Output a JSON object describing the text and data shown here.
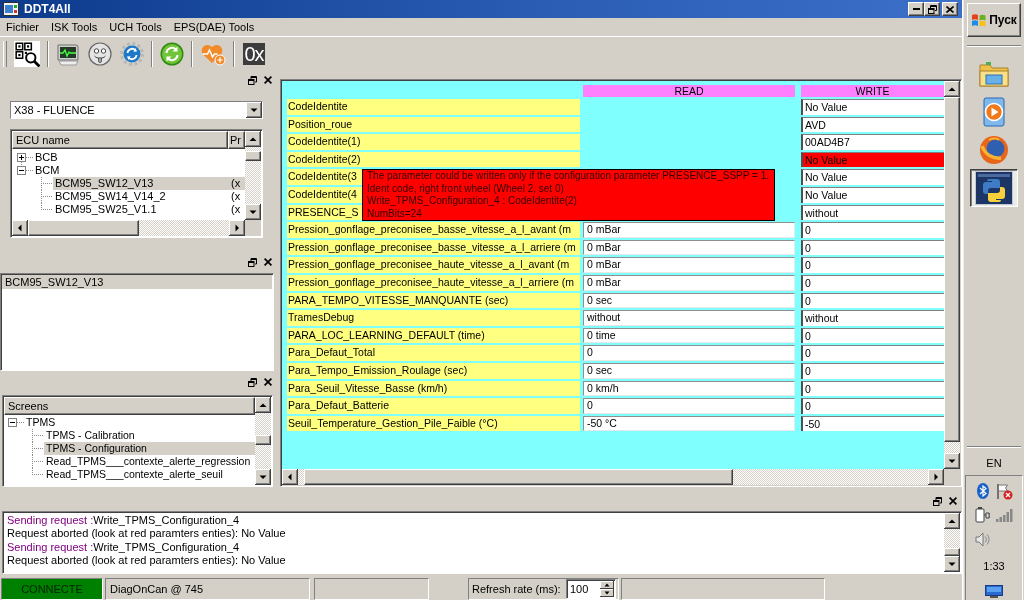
{
  "window": {
    "title": "DDT4All"
  },
  "menu": [
    "Fichier",
    "ISK Tools",
    "UCH Tools",
    "EPS(DAE) Tools"
  ],
  "toolbar": {
    "hex_button": "0x"
  },
  "ecu_panel": {
    "vehicle": "X38 - FLUENCE",
    "columns": [
      "ECU name",
      "Pr"
    ],
    "tree": [
      {
        "label": "BCB",
        "expanded": false,
        "selected": false
      },
      {
        "label": "BCM",
        "expanded": true,
        "selected": false,
        "children": [
          {
            "label": "BCM95_SW12_V13",
            "column_2": "(x",
            "selected": true
          },
          {
            "label": "BCM95_SW14_V14_2",
            "column_2": "(x",
            "selected": false
          },
          {
            "label": "BCM95_SW25_V1.1",
            "column_2": "(x",
            "selected": false
          }
        ]
      }
    ]
  },
  "ecu_list": [
    {
      "label": "BCM95_SW12_V13",
      "selected": true
    }
  ],
  "screens_panel": {
    "column": "Screens",
    "tree": [
      {
        "label": "TPMS",
        "expanded": true,
        "selected": false,
        "children": [
          {
            "label": "TPMS - Calibration",
            "selected": false
          },
          {
            "label": "TPMS - Configuration",
            "selected": true
          },
          {
            "label": "Read_TPMS___contexte_alerte_regression",
            "selected": false
          },
          {
            "label": "Read_TPMS___contexte_alerte_seuil",
            "selected": false
          }
        ]
      }
    ]
  },
  "parameters": {
    "columns": [
      "READ",
      "WRITE"
    ],
    "rows": [
      {
        "label": "CodeIdentite",
        "write": "No Value",
        "error": false
      },
      {
        "label": "Position_roue",
        "write": "AVD",
        "error": false
      },
      {
        "label": "CodeIdentite(1)",
        "write": "00AD4B7",
        "error": false
      },
      {
        "label": "CodeIdentite(2)",
        "write": "No Value",
        "error": true
      },
      {
        "label": "CodeIdentite(3",
        "write": "No Value",
        "error": false
      },
      {
        "label": "CodeIdentite(4",
        "write": "No Value",
        "error": false
      },
      {
        "label": "PRESENCE_S",
        "write": "without",
        "error": false
      },
      {
        "label": "Pression_gonflage_preconisee_basse_vitesse_a_l_avant (m",
        "read": "0 mBar",
        "write": "0",
        "error": false
      },
      {
        "label": "Pression_gonflage_preconisee_basse_vitesse_a_l_arriere (m",
        "read": "0 mBar",
        "write": "0",
        "error": false
      },
      {
        "label": "Pression_gonflage_preconisee_haute_vitesse_a_l_avant (m",
        "read": "0 mBar",
        "write": "0",
        "error": false
      },
      {
        "label": "Pression_gonflage_preconisee_haute_vitesse_a_l_arriere (m",
        "read": "0 mBar",
        "write": "0",
        "error": false
      },
      {
        "label": "PARA_TEMPO_VITESSE_MANQUANTE (sec)",
        "read": "0 sec",
        "write": "0",
        "error": false
      },
      {
        "label": "TramesDebug",
        "read": "without",
        "write": "without",
        "error": false
      },
      {
        "label": "PARA_LOC_LEARNING_DEFAULT (time)",
        "read": "0 time",
        "write": "0",
        "error": false
      },
      {
        "label": "Para_Defaut_Total",
        "read": "0",
        "write": "0",
        "error": false
      },
      {
        "label": "Para_Tempo_Emission_Roulage (sec)",
        "read": "0 sec",
        "write": "0",
        "error": false
      },
      {
        "label": "Para_Seuil_Vitesse_Basse (km/h)",
        "read": "0 km/h",
        "write": "0",
        "error": false
      },
      {
        "label": "Para_Defaut_Batterie",
        "read": "0",
        "write": "0",
        "error": false
      },
      {
        "label": "Seuil_Temperature_Gestion_Pile_Faible (°C)",
        "read": "-50 °C",
        "write": "-50",
        "error": false
      }
    ],
    "tooltip": [
      "The parameter could be written only if the configuration parameter PRESENCE_SSPP = 1.",
      "Ident code, right front wheel (Wheel 2, set 0)",
      "Write_TPMS_Configuration_4 : CodeIdentite(2)",
      "NumBits=24"
    ]
  },
  "log": [
    {
      "kind": "request",
      "prefix": "Sending request :",
      "text": "Write_TPMS_Configuration_4"
    },
    {
      "kind": "message",
      "text": "Request aborted (look at red paramters enties): No Value"
    },
    {
      "kind": "request",
      "prefix": "Sending request :",
      "text": "Write_TPMS_Configuration_4"
    },
    {
      "kind": "message",
      "text": "Request aborted (look at red paramters enties): No Value"
    }
  ],
  "status_bar": {
    "connection": "CONNECTE",
    "connected": true,
    "protocol": "DiagOnCan @ 745",
    "refresh_label": "Refresh rate (ms):",
    "refresh_value": "100"
  },
  "taskbar": {
    "start": "Пуск",
    "apps": [
      {
        "kind": "folder",
        "selected": false
      },
      {
        "kind": "player",
        "selected": false
      },
      {
        "kind": "browser",
        "selected": false
      },
      {
        "kind": "editor",
        "selected": true
      }
    ],
    "language": "EN",
    "clock": "1:33"
  }
}
